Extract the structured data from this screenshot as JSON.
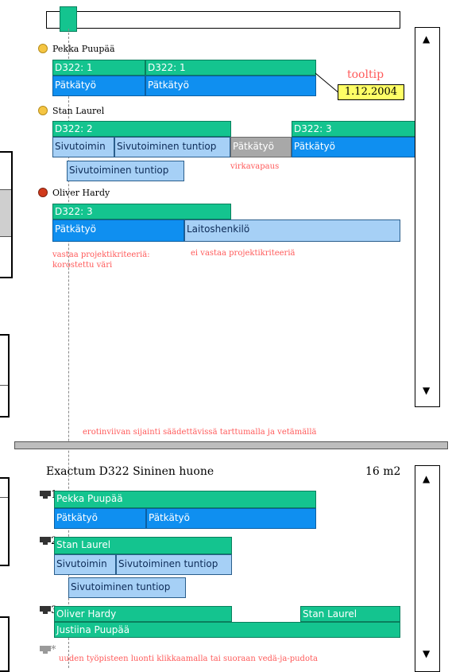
{
  "top": {
    "people": [
      {
        "name": "Pekka Puupää",
        "mood": "happy"
      },
      {
        "name": "Stan Laurel",
        "mood": "happy"
      },
      {
        "name": "Oliver Hardy",
        "mood": "unhappy"
      }
    ],
    "pekka": {
      "project_a": "D322: 1",
      "project_b": "D322: 1",
      "task_a": "Pätkätyö",
      "task_b": "Pätkätyö"
    },
    "tooltip": {
      "label": "tooltip",
      "date": "1.12.2004"
    },
    "stan": {
      "project_a": "D322: 2",
      "project_b": "D322: 3",
      "task_1": "Sivutoimin",
      "task_2": "Sivutoiminen tuntiop",
      "task_3": "Pätkätyö",
      "task_4": "Pätkätyö",
      "task_5": "Sivutoiminen tuntiop",
      "note_leave": "virkavapaus"
    },
    "oliver": {
      "project": "D322: 3",
      "task_1": "Pätkätyö",
      "task_2": "Laitoshenkilö",
      "note_left": "vastaa projektikriteeriä: korostettu väri",
      "note_right": "ei vastaa projektikriteeriä"
    },
    "scroll_up": "▲",
    "scroll_down": "▼"
  },
  "divider": {
    "caption": "erotinviivan sijainti säädettävissä tarttumalla ja vetämällä"
  },
  "room": {
    "title": "Exactum D322 Sininen huone",
    "size": "16 m2",
    "stations": [
      {
        "label": "1"
      },
      {
        "label": "2"
      },
      {
        "label": "3"
      },
      {
        "label": "*"
      }
    ],
    "s1": {
      "name": "Pekka Puupää",
      "task_1": "Pätkätyö",
      "task_2": "Pätkätyö"
    },
    "s2": {
      "name": "Stan Laurel",
      "task_1": "Sivutoimin",
      "task_2": "Sivutoiminen tuntiop",
      "task_3": "Sivutoiminen tuntiop"
    },
    "s3": {
      "name_a": "Oliver Hardy",
      "name_b": "Stan Laurel",
      "name_c": "Justiina Puupää"
    },
    "new_note": "uuden työpisteen luonti klikkaamalla tai suoraan vedä-ja-pudota",
    "scroll_up": "▲",
    "scroll_down": "▼"
  },
  "colors": {
    "teal": "#14c48f",
    "blue": "#0f8ff0",
    "light_blue": "#a6d0f6",
    "gray": "#a8a8a8",
    "note_red": "#ff5a5a",
    "tooltip_bg": "#ffff66"
  }
}
